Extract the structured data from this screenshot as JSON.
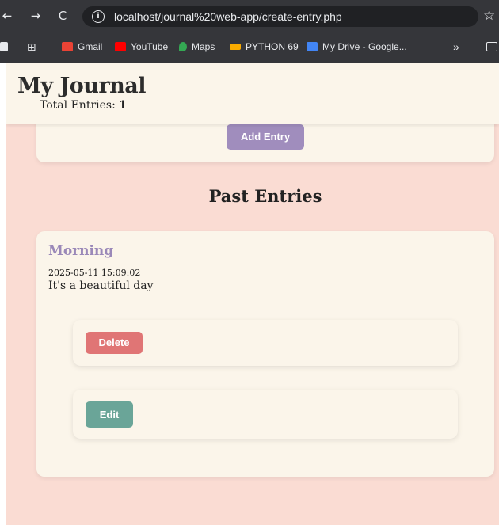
{
  "browser": {
    "url": "localhost/journal%20web-app/create-entry.php",
    "nav_back": "←",
    "nav_forward": "→",
    "nav_reload": "C",
    "bookmarks": [
      {
        "label": "Gmail",
        "color": "#ea4335"
      },
      {
        "label": "YouTube",
        "color": "#ff0000"
      },
      {
        "label": "Maps",
        "color": "#34a853"
      },
      {
        "label": "PYTHON 69",
        "color": "#f9ab00"
      },
      {
        "label": "My Drive - Google...",
        "color": "#4285f4"
      }
    ],
    "more_bookmarks": "»"
  },
  "header": {
    "title": "My Journal",
    "total_label": "Total Entries:",
    "total_count": "1"
  },
  "add_entry": {
    "button_label": "Add Entry"
  },
  "past_entries": {
    "heading": "Past Entries",
    "entries": [
      {
        "title": "Morning",
        "timestamp": "2025-05-11 15:09:02",
        "body": "It's a beautiful day",
        "delete_label": "Delete",
        "edit_label": "Edit"
      }
    ]
  },
  "colors": {
    "page_bg": "#fadcd3",
    "card_bg": "#fbf5ea",
    "add_button": "#a08dbd",
    "delete_button": "#e07575",
    "edit_button": "#6aa598",
    "entry_title": "#9a88b8"
  }
}
